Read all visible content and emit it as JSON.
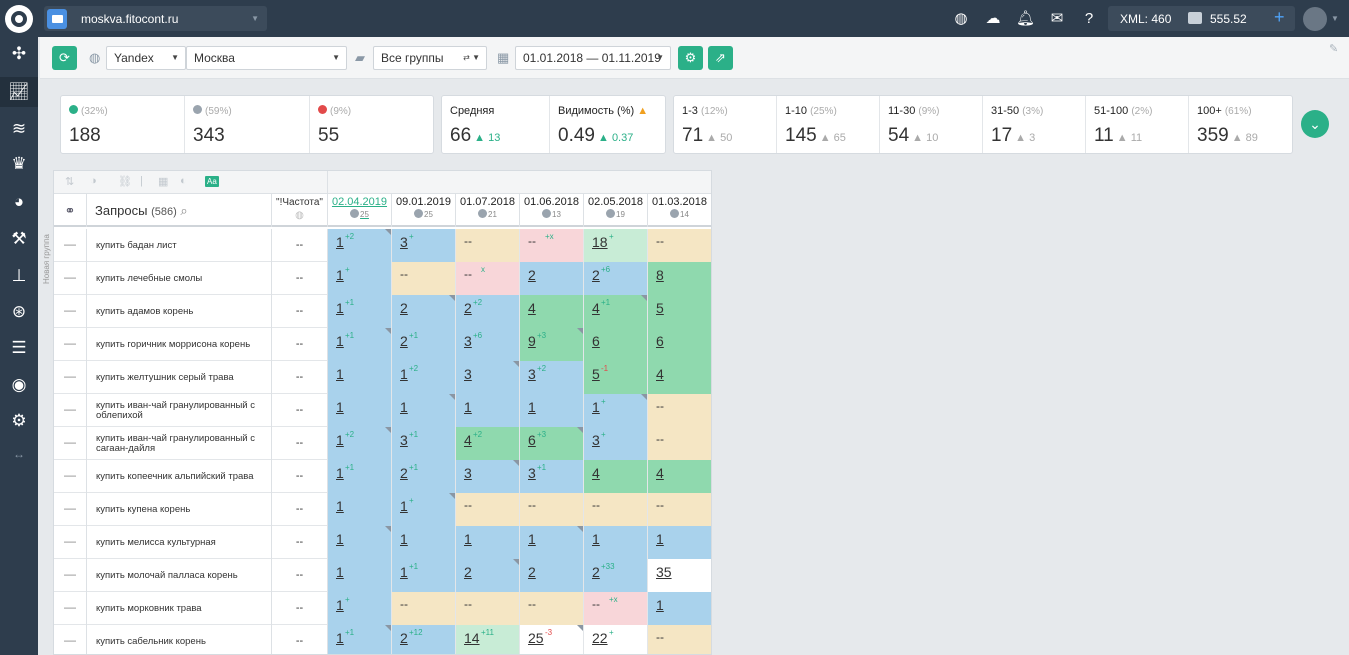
{
  "topbar": {
    "site": "moskva.fitocont.ru",
    "xml": "XML: 460",
    "balance": "555.52",
    "icons": [
      "globe-icon",
      "weather-icon",
      "bell-icon",
      "mail-icon",
      "help-icon"
    ]
  },
  "sidebar": {
    "icons": [
      "network-icon",
      "chart-icon",
      "layers-icon",
      "trophy-icon",
      "pie-icon",
      "hammer-icon",
      "sitemap-icon",
      "lifebuoy-icon",
      "list-icon",
      "eye-icon",
      "gear-icon",
      "arrows-icon"
    ]
  },
  "toolbar": {
    "engine": "Yandex",
    "region": "Москва",
    "groups": "Все группы",
    "dates": "01.01.2018 — 01.11.2019"
  },
  "stats": {
    "changes": [
      {
        "pct": "(32%)",
        "val": "188",
        "color": "#2bb088"
      },
      {
        "pct": "(59%)",
        "val": "343",
        "color": "#9aa4ae"
      },
      {
        "pct": "(9%)",
        "val": "55",
        "color": "#e24a4a"
      }
    ],
    "avg": {
      "label": "Средняя",
      "val": "66",
      "delta": "13"
    },
    "vis": {
      "label": "Видимость (%)",
      "val": "0.49",
      "delta": "0.37"
    },
    "ranges": [
      {
        "label": "1-3",
        "pct": "(12%)",
        "val": "71",
        "delta": "50"
      },
      {
        "label": "1-10",
        "pct": "(25%)",
        "val": "145",
        "delta": "65"
      },
      {
        "label": "11-30",
        "pct": "(9%)",
        "val": "54",
        "delta": "10"
      },
      {
        "label": "31-50",
        "pct": "(3%)",
        "val": "17",
        "delta": "3"
      },
      {
        "label": "51-100",
        "pct": "(2%)",
        "val": "11",
        "delta": "11"
      },
      {
        "label": "100+",
        "pct": "(61%)",
        "val": "359",
        "delta": "89"
      }
    ]
  },
  "table": {
    "vertical_label": "Новая группа",
    "queries_label": "Запросы",
    "queries_count": "(586)",
    "freq_label": "\"!Частота\"",
    "dates": [
      {
        "d": "02.04.2019",
        "n": "25"
      },
      {
        "d": "09.01.2019",
        "n": "25"
      },
      {
        "d": "01.07.2018",
        "n": "21"
      },
      {
        "d": "01.06.2018",
        "n": "13"
      },
      {
        "d": "02.05.2018",
        "n": "19"
      },
      {
        "d": "01.03.2018",
        "n": "14"
      }
    ],
    "rows": [
      {
        "kw": "купить бадан лист",
        "fr": "--",
        "c": [
          [
            "1",
            "+2"
          ],
          [
            "3",
            "+"
          ],
          [
            "--",
            ""
          ],
          [
            "--",
            "+x"
          ],
          [
            "18",
            "+"
          ],
          [
            "--",
            ""
          ]
        ]
      },
      {
        "kw": "купить лечебные смолы",
        "fr": "--",
        "c": [
          [
            "1",
            "+"
          ],
          [
            "--",
            ""
          ],
          [
            "--",
            "x"
          ],
          [
            "2",
            ""
          ],
          [
            "2",
            "+6"
          ],
          [
            "8",
            ""
          ]
        ]
      },
      {
        "kw": "купить адамов корень",
        "fr": "--",
        "c": [
          [
            "1",
            "+1"
          ],
          [
            "2",
            ""
          ],
          [
            "2",
            "+2"
          ],
          [
            "4",
            ""
          ],
          [
            "4",
            "+1"
          ],
          [
            "5",
            ""
          ]
        ]
      },
      {
        "kw": "купить горичник моррисона корень",
        "fr": "--",
        "c": [
          [
            "1",
            "+1"
          ],
          [
            "2",
            "+1"
          ],
          [
            "3",
            "+6"
          ],
          [
            "9",
            "+3"
          ],
          [
            "6",
            ""
          ],
          [
            "6",
            ""
          ]
        ]
      },
      {
        "kw": "купить желтушник серый трава",
        "fr": "--",
        "c": [
          [
            "1",
            ""
          ],
          [
            "1",
            "+2"
          ],
          [
            "3",
            ""
          ],
          [
            "3",
            "+2"
          ],
          [
            "5",
            "-1"
          ],
          [
            "4",
            ""
          ]
        ]
      },
      {
        "kw": "купить иван-чай гранулированный с облепихой",
        "fr": "--",
        "c": [
          [
            "1",
            ""
          ],
          [
            "1",
            ""
          ],
          [
            "1",
            ""
          ],
          [
            "1",
            ""
          ],
          [
            "1",
            "+"
          ],
          [
            "--",
            ""
          ]
        ]
      },
      {
        "kw": "купить иван-чай гранулированный с сагаан-дайля",
        "fr": "--",
        "c": [
          [
            "1",
            "+2"
          ],
          [
            "3",
            "+1"
          ],
          [
            "4",
            "+2"
          ],
          [
            "6",
            "+3"
          ],
          [
            "3",
            "+"
          ],
          [
            "--",
            ""
          ]
        ]
      },
      {
        "kw": "купить копеечник альпийский трава",
        "fr": "--",
        "c": [
          [
            "1",
            "+1"
          ],
          [
            "2",
            "+1"
          ],
          [
            "3",
            ""
          ],
          [
            "3",
            "+1"
          ],
          [
            "4",
            ""
          ],
          [
            "4",
            ""
          ]
        ]
      },
      {
        "kw": "купить купена корень",
        "fr": "--",
        "c": [
          [
            "1",
            ""
          ],
          [
            "1",
            "+"
          ],
          [
            "--",
            ""
          ],
          [
            "--",
            ""
          ],
          [
            "--",
            ""
          ],
          [
            "--",
            ""
          ]
        ]
      },
      {
        "kw": "купить мелисса культурная",
        "fr": "--",
        "c": [
          [
            "1",
            ""
          ],
          [
            "1",
            ""
          ],
          [
            "1",
            ""
          ],
          [
            "1",
            ""
          ],
          [
            "1",
            ""
          ],
          [
            "1",
            ""
          ]
        ]
      },
      {
        "kw": "купить молочай палласа корень",
        "fr": "--",
        "c": [
          [
            "1",
            ""
          ],
          [
            "1",
            "+1"
          ],
          [
            "2",
            ""
          ],
          [
            "2",
            ""
          ],
          [
            "2",
            "+33"
          ],
          [
            "35",
            ""
          ]
        ]
      },
      {
        "kw": "купить морковник трава",
        "fr": "--",
        "c": [
          [
            "1",
            "+"
          ],
          [
            "--",
            ""
          ],
          [
            "--",
            ""
          ],
          [
            "--",
            ""
          ],
          [
            "--",
            "+x"
          ],
          [
            "1",
            ""
          ]
        ]
      },
      {
        "kw": "купить сабельник корень",
        "fr": "--",
        "c": [
          [
            "1",
            "+1"
          ],
          [
            "2",
            "+12"
          ],
          [
            "14",
            "+11"
          ],
          [
            "25",
            "-3"
          ],
          [
            "22",
            "+"
          ],
          [
            "--",
            ""
          ]
        ]
      }
    ]
  }
}
